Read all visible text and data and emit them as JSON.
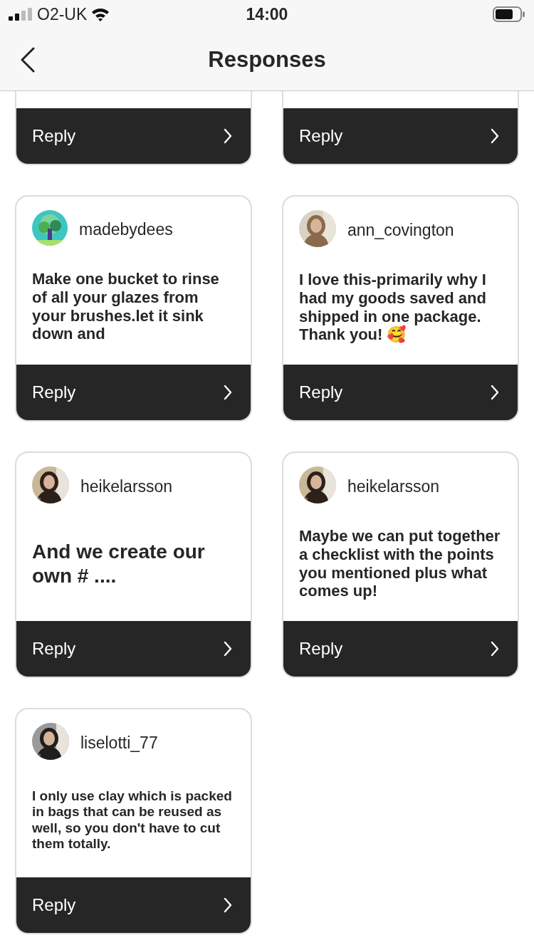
{
  "status_bar": {
    "carrier": "O2-UK",
    "time": "14:00"
  },
  "nav": {
    "title": "Responses"
  },
  "cards": [
    {
      "kind": "partial",
      "reply": "Reply"
    },
    {
      "kind": "partial",
      "reply": "Reply"
    },
    {
      "kind": "full",
      "username": "madebydees",
      "message": "Make one bucket to rinse of all your glazes from your brushes.let it sink down and",
      "reply": "Reply"
    },
    {
      "kind": "full",
      "username": "ann_covington",
      "message": "I love this-primarily why I had my goods saved and shipped in one package. Thank you! 🥰",
      "reply": "Reply"
    },
    {
      "kind": "full",
      "username": "heikelarsson",
      "message": "And we create our own # ....",
      "reply": "Reply"
    },
    {
      "kind": "full",
      "username": "heikelarsson",
      "message": "Maybe we can put together a checklist with the points you mentioned plus what comes up!",
      "reply": "Reply"
    },
    {
      "kind": "full",
      "username": "liselotti_77",
      "message": "I only use clay which is packed in bags that can be reused as well, so you don't have to cut them totally.",
      "reply": "Reply"
    }
  ]
}
